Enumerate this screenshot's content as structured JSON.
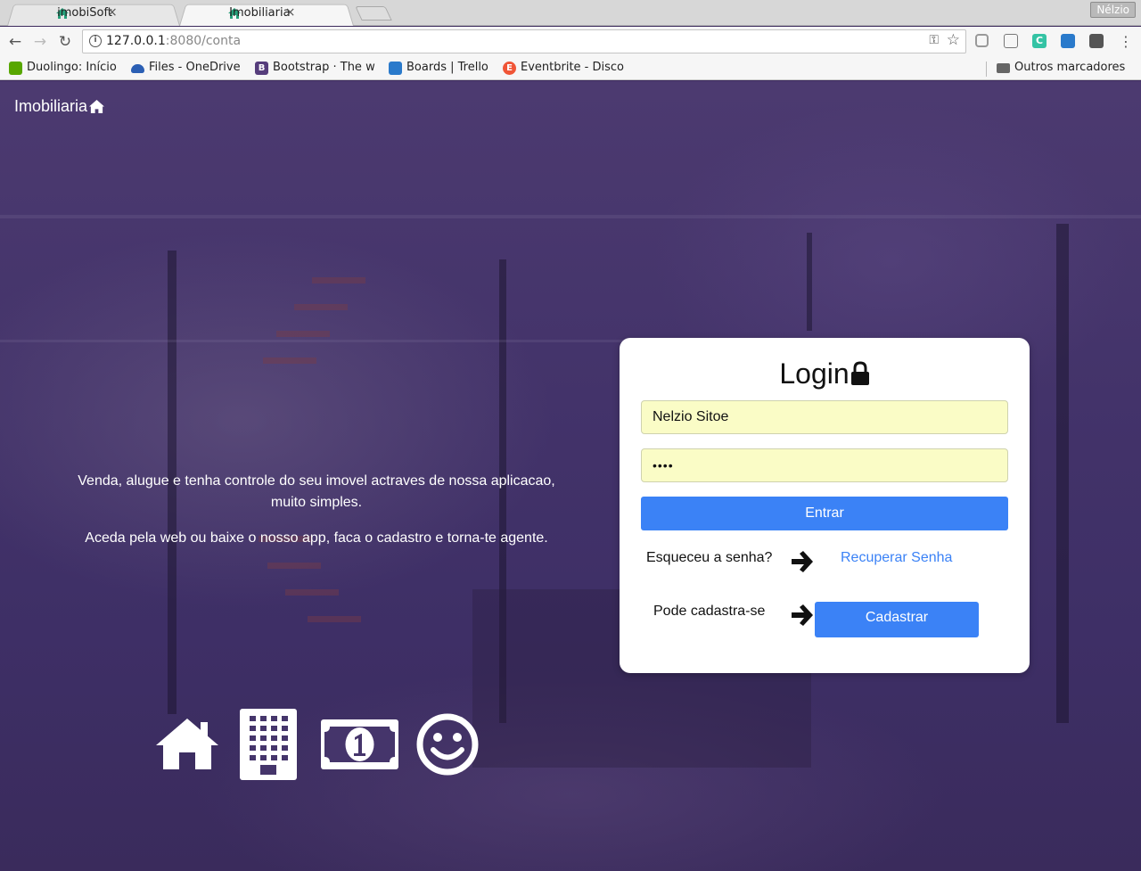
{
  "browser": {
    "tabs": [
      {
        "title": "imobiSoft",
        "close": "×"
      },
      {
        "title": "Imobiliaria",
        "close": "×"
      }
    ],
    "profile_name": "Nélzio",
    "url_host": "127.0.0.1",
    "url_rest": ":8080/conta",
    "bookmarks": [
      {
        "label": "Duolingo: Início",
        "color": "#58a700"
      },
      {
        "label": "Files - OneDrive",
        "color": "#2b5fb4"
      },
      {
        "label": "Bootstrap · The w",
        "color": "#563d7c",
        "glyph": "B"
      },
      {
        "label": "Boards | Trello",
        "color": "#2a7acb"
      },
      {
        "label": "Eventbrite - Disco",
        "color": "#f05537",
        "glyph": "E"
      }
    ],
    "other_bookmarks": "Outros marcadores"
  },
  "page": {
    "brand": "Imobiliaria",
    "tagline_1": "Venda, alugue e tenha controle do seu imovel actraves de nossa aplicacao, muito simples.",
    "tagline_2": "Aceda pela web ou baixe o nosso app, faca o cadastro e torna-te agente.",
    "feature_icons": [
      "home-icon",
      "building-icon",
      "money-bill-icon",
      "smile-icon"
    ]
  },
  "login": {
    "title": "Login",
    "username_value": "Nelzio Sitoe",
    "password_value": "••••",
    "submit_label": "Entrar",
    "forgot_text": "Esqueceu a senha?",
    "recover_link": "Recuperar Senha",
    "register_text": "Pode cadastra-se",
    "register_button": "Cadastrar"
  },
  "colors": {
    "accent": "#3b82f6",
    "field_bg": "#fafcc6",
    "background": "#43336a"
  }
}
